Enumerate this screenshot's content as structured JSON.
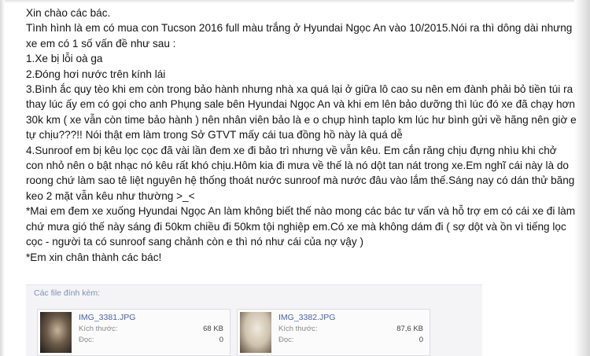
{
  "post": {
    "lines": [
      "Xin chào các bác.",
      "Tình hình là em có mua con Tucson 2016 full màu trắng ở Hyundai Ngọc An vào 10/2015.Nói ra thì dông dài nhưng xe em có 1 số vấn đề như sau :",
      "1.Xe bị lỗi oà ga",
      "2.Đóng hơi nước trên kính lái",
      "3.Bình ắc quy tèo khi em còn trong bảo hành nhưng nhà xa quá lại ở giữa lô cao su nên em đành phải bỏ tiền túi ra thay lúc ấy em có gọi cho anh Phụng sale bên Hyundai Ngọc An và khi em lên bảo dưỡng thì lúc đó xe đã chạy hơn 30k km ( xe vẫn còn time bảo hành ) nên nhân viên bảo là e o chụp hình taplo km lúc hư bình gửi về hãng nên giờ e tự chịu???!! Nói thật em làm trong Sở GTVT mấy cái tua đồng hồ này là quá dễ",
      "4.Sunroof em bị kêu lọc cọc đã vài lần đem xe đi bảo trì nhưng về vẫn kêu. Em cắn răng chịu đựng nhìu khi chở con nhỏ nên o bật nhạc nó kêu rất khó chịu.Hôm kia đi mưa về thế là nó dột tan nát trong xe.Em nghĩ cái này là do roong chứ làm sao tê liệt nguyên hệ thống thoát nước sunroof mà nước đâu vào lắm thế.Sáng nay có dán thử băng keo 2 mặt vẫn kêu như thường >_<",
      "*Mai em đem xe xuống Hyundai Ngọc An làm không biết thế nào mong các bác tư vấn và hỗ trợ em có cái xe đi làm chứ mưa gió thế này sáng đi 50km chiều đi 50km tội nghiệp em.Có xe mà không dám đi ( sợ dột và ồn vì tiếng lọc cọc - người ta có sunroof sang chảnh còn e thì nó như cái của nợ vậy )",
      "*Em xin chân thành các bác!"
    ]
  },
  "attachments": {
    "header": "Các file đính kèm:",
    "items": [
      {
        "filename": "IMG_3381.JPG",
        "size_label": "Kích thước:",
        "size_value": "68 KB",
        "views_label": "Đọc:",
        "views_value": "0",
        "thumb": "dark-interior-photo"
      },
      {
        "filename": "IMG_3382.JPG",
        "size_label": "Kích thước:",
        "size_value": "87,6 KB",
        "views_label": "Đọc:",
        "views_value": "0",
        "thumb": "light-interior-photo"
      }
    ]
  }
}
